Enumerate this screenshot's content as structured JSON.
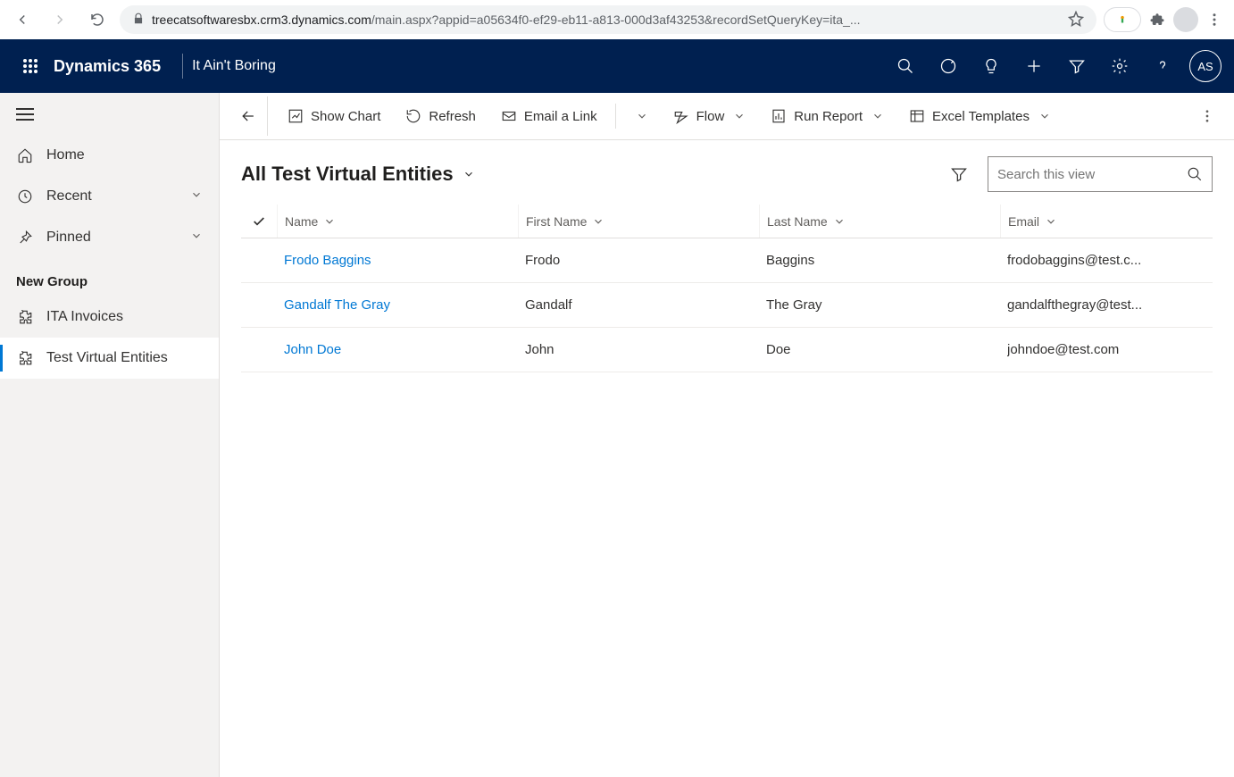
{
  "browser": {
    "url_host": "treecatsoftwaresbx.crm3.dynamics.com",
    "url_path": "/main.aspx?appid=a05634f0-ef29-eb11-a813-000d3af43253&recordSetQueryKey=ita_..."
  },
  "header": {
    "product": "Dynamics 365",
    "app_name": "It Ain't Boring",
    "avatar_initials": "AS"
  },
  "nav": {
    "home": "Home",
    "recent": "Recent",
    "pinned": "Pinned",
    "group_label": "New Group",
    "items": [
      {
        "label": "ITA Invoices"
      },
      {
        "label": "Test Virtual Entities"
      }
    ]
  },
  "commands": {
    "show_chart": "Show Chart",
    "refresh": "Refresh",
    "email_link": "Email a Link",
    "flow": "Flow",
    "run_report": "Run Report",
    "excel_templates": "Excel Templates"
  },
  "view": {
    "title": "All Test Virtual Entities",
    "search_placeholder": "Search this view"
  },
  "grid": {
    "columns": {
      "name": "Name",
      "first": "First Name",
      "last": "Last Name",
      "email": "Email"
    },
    "rows": [
      {
        "name": "Frodo Baggins",
        "first": "Frodo",
        "last": "Baggins",
        "email": "frodobaggins@test.c..."
      },
      {
        "name": "Gandalf The Gray",
        "first": "Gandalf",
        "last": "The Gray",
        "email": "gandalfthegray@test..."
      },
      {
        "name": "John Doe",
        "first": "John",
        "last": "Doe",
        "email": "johndoe@test.com"
      }
    ]
  }
}
